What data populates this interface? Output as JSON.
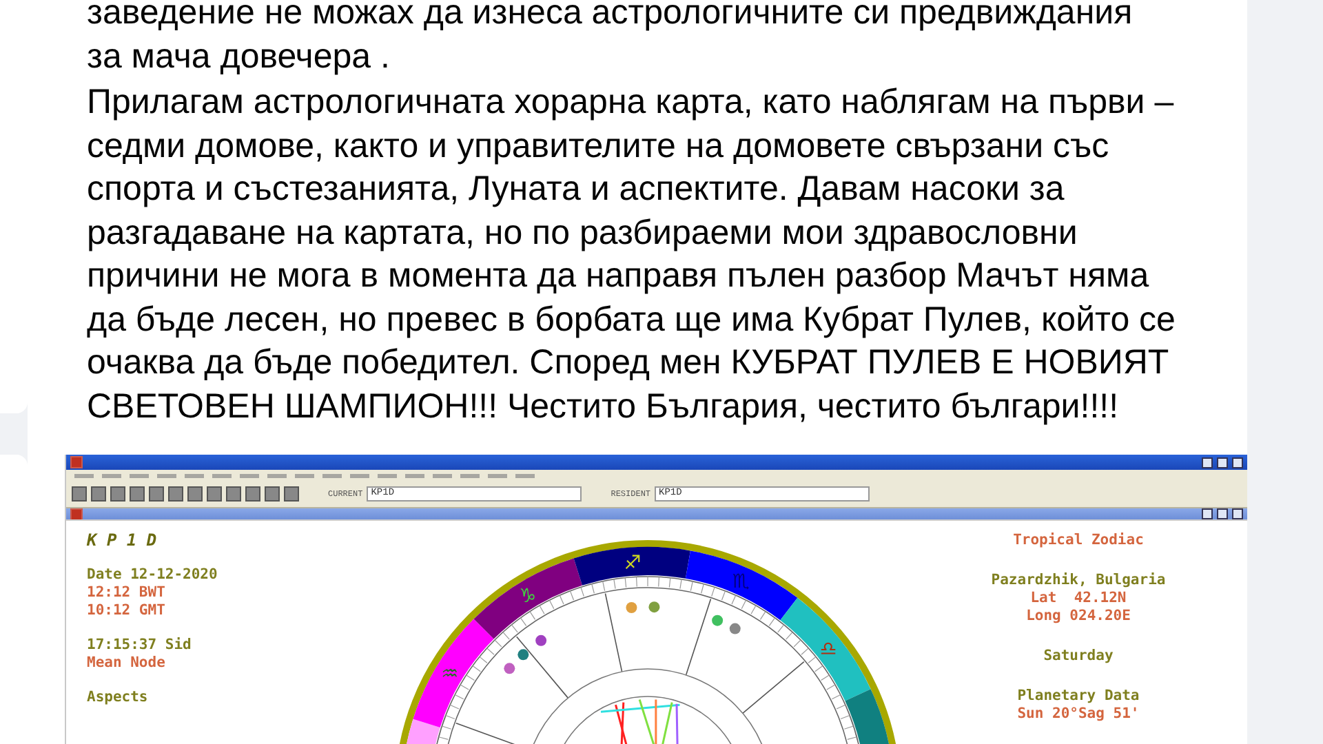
{
  "post": {
    "paragraphs": [
      "заведение не можах да изнеса астрологичните си предвиждания\nза мача довечера .",
      "Прилагам астрологичната хорарна карта, като наблягам на първи –\nседми домове, както и управителите на домовете свързани със\nспорта и състезанията, Луната и аспектите. Давам насоки за\nразгадаване на картата, но по разбираеми мои здравословни\nпричини не мога в момента да направя пълен разбор Мачът няма\nда бъде лесен, но превес в борбата ще има Кубрат Пулев, който се\nочаква да бъде победител. Според мен КУБРАТ ПУЛЕВ Е НОВИЯТ\nСВЕТОВЕН ШАМПИОН!!! Честито България, честито българи!!!!"
    ]
  },
  "software": {
    "toolbar_fields": [
      {
        "label": "CURRENT",
        "value": "KP1D"
      },
      {
        "label": "RESIDENT",
        "value": "KP1D"
      }
    ],
    "left_info": [
      [
        {
          "text": "K P 1 D",
          "kind": "heading"
        }
      ],
      [
        {
          "text": "Date 12-12-2020",
          "kind": "olive"
        },
        {
          "text": "12:12 BWT",
          "kind": "orange"
        },
        {
          "text": "10:12 GMT",
          "kind": "orange"
        }
      ],
      [
        {
          "text": "17:15:37 Sid",
          "kind": "olive"
        },
        {
          "text": "Mean Node",
          "kind": "orange"
        }
      ],
      [
        {
          "text": "Aspects",
          "kind": "olive"
        }
      ]
    ],
    "right_info": [
      [
        {
          "text": "Tropical Zodiac",
          "kind": "orange"
        }
      ],
      [
        {
          "text": "Pazardzhik, Bulgaria",
          "kind": "olive"
        },
        {
          "text": "Lat  42.12N",
          "kind": "orange"
        },
        {
          "text": "Long 024.20E",
          "kind": "orange"
        }
      ],
      [
        {
          "text": "Saturday",
          "kind": "olive"
        }
      ],
      [
        {
          "text": "Planetary Data",
          "kind": "olive"
        },
        {
          "text": "Sun 20°Sag 51'",
          "kind": "orange"
        }
      ]
    ],
    "signs": [
      {
        "color": "#ffa0ff"
      },
      {
        "glyph": "♒",
        "color": "#ff00ff"
      },
      {
        "glyph": "♑",
        "color": "#800080"
      },
      {
        "glyph": "♐",
        "color": "#000080"
      },
      {
        "glyph": "♏",
        "color": "#0000ff"
      },
      {
        "glyph": "♎",
        "color": "#20c0c0"
      },
      {
        "color": "#108080"
      }
    ]
  }
}
